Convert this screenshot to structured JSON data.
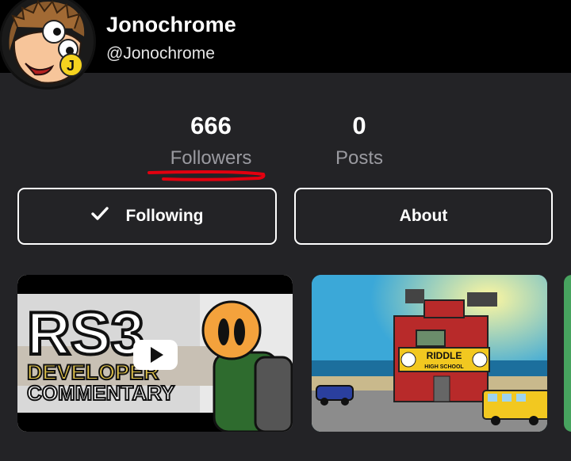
{
  "profile": {
    "name": "Jonochrome",
    "handle": "@Jonochrome"
  },
  "stats": {
    "followers": {
      "count": "666",
      "label": "Followers"
    },
    "posts": {
      "count": "0",
      "label": "Posts"
    }
  },
  "buttons": {
    "following_label": "Following",
    "about_label": "About"
  },
  "cards": [
    {
      "title_line": "RS3",
      "subtitle_1": "DEVELOPER",
      "subtitle_2": "COMMENTARY"
    },
    {
      "sign_title": "RIDDLE",
      "sign_subtitle": "HIGH SCHOOL"
    }
  ],
  "colors": {
    "background": "#232326",
    "header": "#000000",
    "underline": "#e3000f",
    "play_button": "#ffffff"
  },
  "icons": [
    "checkmark-icon",
    "play-icon"
  ]
}
